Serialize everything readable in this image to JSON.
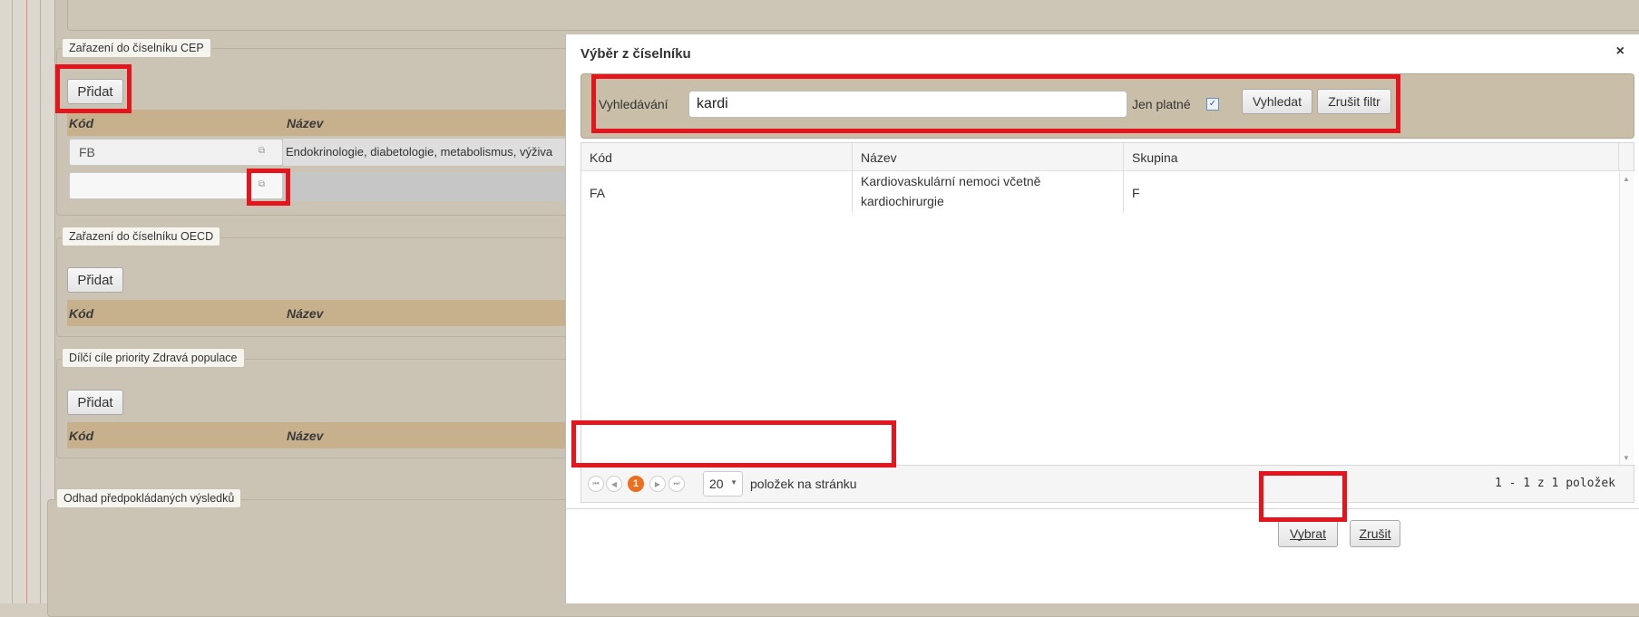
{
  "sections": {
    "cep": {
      "legend": "Zařazení do číselníku CEP",
      "add_label": "Přidat",
      "col_code": "Kód",
      "col_name": "Název",
      "row1_code": "FB",
      "row1_name": "Endokrinologie, diabetologie, metabolismus, výživa",
      "row2_code": ""
    },
    "oecd": {
      "legend": "Zařazení do číselníku OECD",
      "add_label": "Přidat",
      "col_code": "Kód",
      "col_name": "Název"
    },
    "priority": {
      "legend": "Dílčí cíle priority Zdravá populace",
      "add_label": "Přidat",
      "col_code": "Kód",
      "col_name": "Název"
    },
    "results": {
      "legend": "Odhad předpokládaných výsledků"
    }
  },
  "dialog": {
    "title": "Výběr z číselníku",
    "close": "×",
    "search_label": "Vyhledávání",
    "search_value": "kardi",
    "only_valid_label": "Jen platné",
    "only_valid_checked": true,
    "search_button": "Vyhledat",
    "clear_filter_button": "Zrušit filtr",
    "columns": [
      "Kód",
      "Název",
      "Skupina"
    ],
    "rows": [
      {
        "code": "FA",
        "name_line1": "Kardiovaskulární nemoci včetně",
        "name_line2": "kardiochirurgie",
        "group": "F"
      }
    ],
    "pager": {
      "current_page": "1",
      "page_size": "20",
      "per_page_label": "položek na stránku",
      "summary": "1 - 1 z 1 položek"
    },
    "select_button": "Vybrat",
    "cancel_button": "Zrušit"
  },
  "colors": {
    "highlight": "#e4151c",
    "header_row": "#c7b08c",
    "page_bg": "#d2ccbe",
    "pager_current": "#eb6f1f"
  }
}
